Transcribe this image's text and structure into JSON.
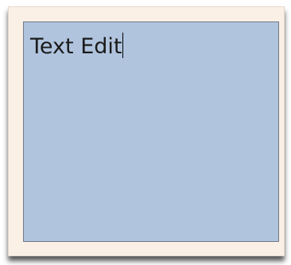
{
  "text_edit": {
    "value": "Text Edit"
  },
  "colors": {
    "panel_background": "#fbf0e6",
    "field_background": "#b0c4de",
    "field_border": "#6f7a86",
    "text": "#1b1b1b"
  }
}
